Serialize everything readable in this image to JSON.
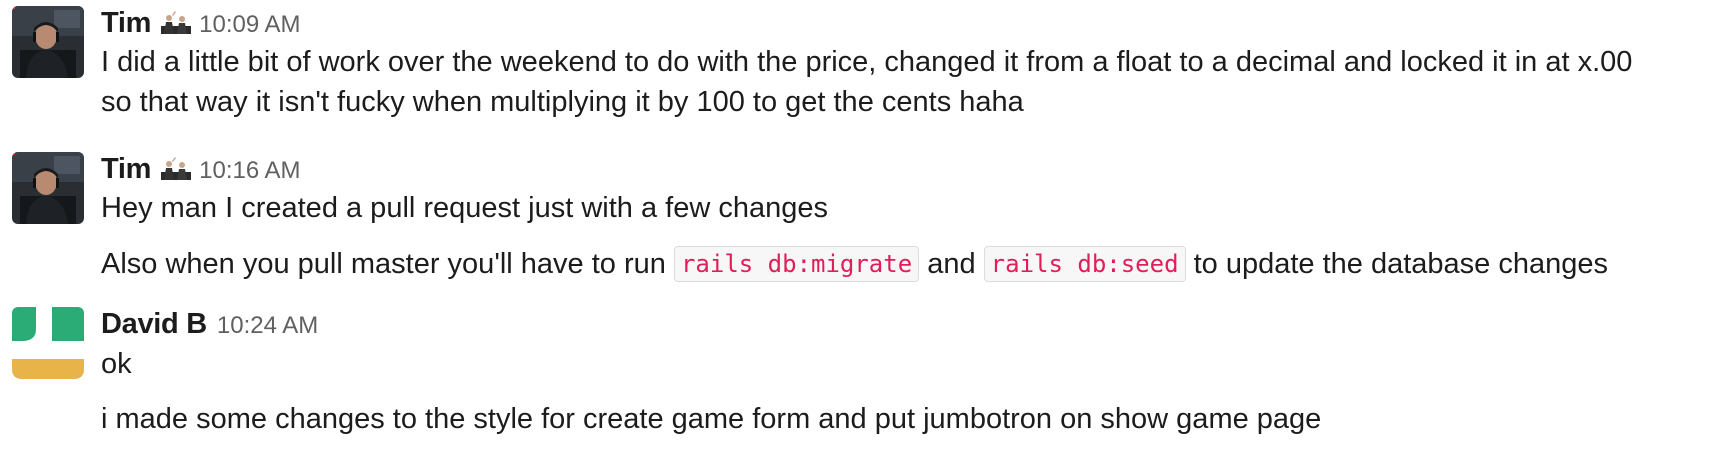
{
  "messages": [
    {
      "sender": "Tim",
      "status_icon": "wave-emoji-icon",
      "time": "10:09 AM",
      "lines": [
        "I did a little bit of work over the weekend to do with the price, changed it from a float to a decimal and locked it in at x.00",
        "so that way it isn't fucky when multiplying it by 100 to get the cents haha"
      ]
    },
    {
      "sender": "Tim",
      "status_icon": "wave-emoji-icon",
      "time": "10:16 AM",
      "lines": [
        "Hey man I created a pull request just with a few changes"
      ],
      "followup": {
        "text_before": "Also when you pull master you'll have to run",
        "code_1": "rails db:migrate",
        "text_middle": "and",
        "code_2": "rails db:seed",
        "text_after": "to update the database changes"
      }
    },
    {
      "sender": "David B",
      "time": "10:24 AM",
      "lines": [
        "ok",
        "i made some changes to the style for create game form and put jumbotron on show game page"
      ]
    }
  ],
  "colors": {
    "text": "#1d1c1d",
    "timestamp": "#616061",
    "code_text": "#e01e5a",
    "code_bg": "#f7f7f7",
    "avatar_green": "#2bac76",
    "avatar_yellow": "#e8b44a"
  }
}
